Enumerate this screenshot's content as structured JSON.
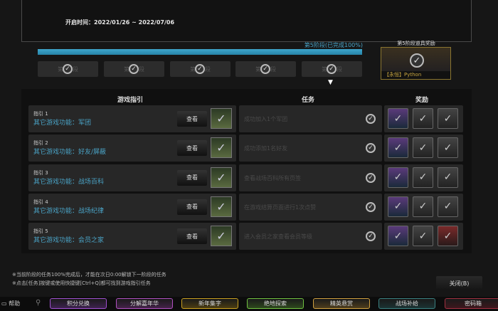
{
  "header": {
    "open_time": "开启时间：2022/01/26 ~ 2022/07/06"
  },
  "progress": {
    "label": "第5阶段(已完成100%)",
    "percent": 100
  },
  "stages": [
    {
      "label": "第1阶段",
      "done": true
    },
    {
      "label": "第2阶段",
      "done": true
    },
    {
      "label": "第3阶段",
      "done": true
    },
    {
      "label": "第4阶段",
      "done": true
    },
    {
      "label": "第5阶段",
      "done": true
    }
  ],
  "stage_reward": {
    "title": "第5阶段道具奖励",
    "name": "【永恒】Python",
    "claimed": true
  },
  "columns": {
    "guide": "游戏指引",
    "task": "任务",
    "reward": "奖励"
  },
  "view_label": "查看",
  "rows": [
    {
      "num": "指引 1",
      "name": "其它游戏功能：军团",
      "task": "成功加入1个军团"
    },
    {
      "num": "指引 2",
      "name": "其它游戏功能：好友/屏蔽",
      "task": "成功添加1名好友"
    },
    {
      "num": "指引 3",
      "name": "其它游戏功能：战场百科",
      "task": "查看战场百科所有页签"
    },
    {
      "num": "指引 4",
      "name": "其它游戏功能：战场纪律",
      "task": "在游戏结算页面进行1次点赞"
    },
    {
      "num": "指引 5",
      "name": "其它游戏功能：会员之家",
      "task": "进入会员之家查看会员等级"
    }
  ],
  "notes": [
    "※当前阶段的任务100%完成后，才能在次日0:00解锁下一阶段的任务",
    "※点击[任务]按键或使用快捷键[Ctrl+Q]都可找到游戏指引任务"
  ],
  "close_label": "关闭(B)",
  "bottom": {
    "help": "帮助",
    "buttons": [
      {
        "label": "积分兑换",
        "color": "#a050d0"
      },
      {
        "label": "分解嘉年华",
        "color": "#b050c0"
      },
      {
        "label": "新年集字",
        "color": "#c9a020"
      },
      {
        "label": "绝地探索",
        "color": "#70c040"
      },
      {
        "label": "精英悬赏",
        "color": "#d0a040"
      },
      {
        "label": "战场补给",
        "color": "#3a8080"
      },
      {
        "label": "密码箱",
        "color": "#a03040"
      }
    ]
  }
}
